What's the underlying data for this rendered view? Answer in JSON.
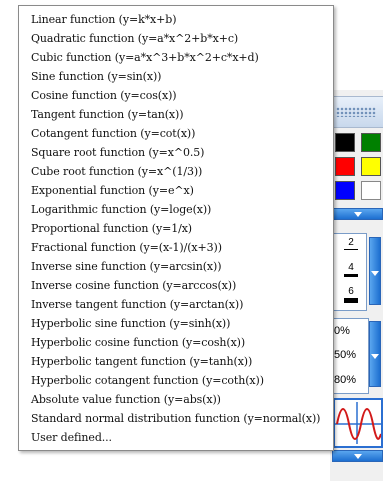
{
  "menu": {
    "items": [
      "Linear function (y=k*x+b)",
      "Quadratic function (y=a*x^2+b*x+c)",
      "Cubic function (y=a*x^3+b*x^2+c*x+d)",
      "Sine function (y=sin(x))",
      "Cosine function (y=cos(x))",
      "Tangent function (y=tan(x))",
      "Cotangent function (y=cot(x))",
      "Square root function (y=x^0.5)",
      "Cube root function (y=x^(1/3))",
      "Exponential function (y=e^x)",
      "Logarithmic function (y=loge(x))",
      "Proportional function (y=1/x)",
      "Fractional function (y=(x-1)/(x+3))",
      "Inverse sine function (y=arcsin(x))",
      "Inverse cosine function (y=arccos(x))",
      "Inverse tangent function (y=arctan(x))",
      "Hyperbolic sine function (y=sinh(x))",
      "Hyperbolic cosine function (y=cosh(x))",
      "Hyperbolic tangent function (y=tanh(x))",
      "Hyperbolic cotangent function (y=coth(x))",
      "Absolute value function (y=abs(x))",
      "Standard normal distribution function (y=normal(x))",
      "User defined..."
    ]
  },
  "toolbar": {
    "colors": [
      "#000000",
      "#008000",
      "#ff0000",
      "#ffff00",
      "#0000ff",
      "#ffffff"
    ],
    "line_widths": [
      "2",
      "4",
      "6"
    ],
    "opacity_options": [
      "0%",
      "50%",
      "80%"
    ],
    "accent_color": "#2b6fd1",
    "graph_line_color": "#d21a1a"
  }
}
